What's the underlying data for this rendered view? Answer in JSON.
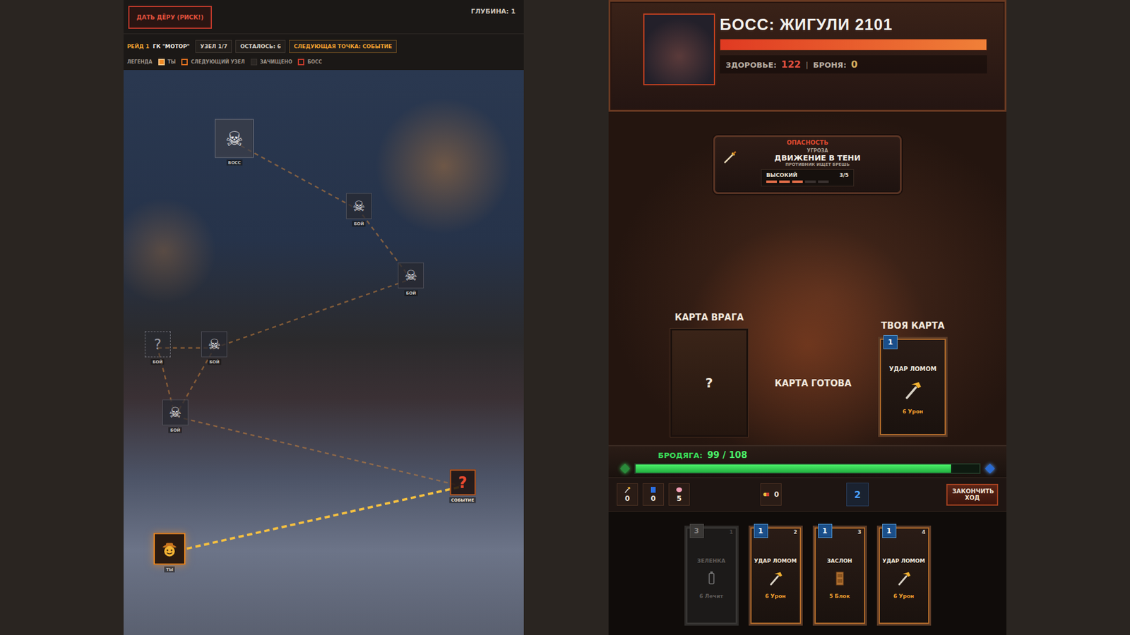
{
  "map_panel": {
    "flee_button": "ДАТЬ ДЁРУ (РИСК!)",
    "depth": "ГЛУБИНА: 1",
    "raid": "РЕЙД 1",
    "location": "ГК \"МОТОР\"",
    "chips": [
      {
        "label": "УЗЕЛ 1/7",
        "highlight": false
      },
      {
        "label": "ОСТАЛОСЬ: 6",
        "highlight": false
      },
      {
        "label": "СЛЕДУЮЩАЯ ТОЧКА: СОБЫТИЕ",
        "highlight": true
      }
    ],
    "legend": {
      "title": "ЛЕГЕНДА",
      "items": [
        {
          "label": "ТЫ",
          "kind": "you"
        },
        {
          "label": "СЛЕДУЮЩИЙ УЗЕЛ",
          "kind": "next"
        },
        {
          "label": "ЗАЧИЩЕНО",
          "kind": "cleared"
        },
        {
          "label": "БОСС",
          "kind": "boss"
        }
      ]
    },
    "nodes": [
      {
        "label": "БОСС",
        "glyph": "☠",
        "kind": "boss"
      },
      {
        "label": "БОЙ",
        "glyph": "☠",
        "kind": "fight"
      },
      {
        "label": "БОЙ",
        "glyph": "☠",
        "kind": "fight"
      },
      {
        "label": "БОЙ",
        "glyph": "?",
        "kind": "unknown"
      },
      {
        "label": "БОЙ",
        "glyph": "☠",
        "kind": "fight"
      },
      {
        "label": "БОЙ",
        "glyph": "☠",
        "kind": "fight"
      },
      {
        "label": "СОБЫТИЕ",
        "glyph": "?",
        "kind": "next"
      },
      {
        "label": "ТЫ",
        "glyph": "",
        "kind": "you"
      }
    ]
  },
  "battle": {
    "boss": {
      "title": "БОСС: ЖИГУЛИ 2101",
      "hp_level": 1,
      "health_label": "ЗДОРОВЬЕ:",
      "health": "122",
      "separator": "|",
      "armor_label": "БРОНЯ:",
      "armor": "0"
    },
    "threat": {
      "header": "ОПАСНОСТЬ",
      "kicker": "УГРОЗА",
      "title": "ДВИЖЕНИЕ В ТЕНИ",
      "subtitle": "ПРОТИВНИК ИЩЕТ БРЕШЬ",
      "level_label": "ВЫСОКИЙ",
      "level_text": "3/5",
      "segments": [
        true,
        true,
        true,
        false,
        false
      ]
    },
    "enemy_card": {
      "label": "КАРТА ВРАГА",
      "glyph": "?"
    },
    "status": "КАРТА ГОТОВА",
    "played_card": {
      "label": "ТВОЯ КАРТА",
      "cost": "1",
      "name": "УДАР ЛОМОМ",
      "effect": "6 Урон",
      "kind": "attack"
    },
    "player": {
      "name": "БРОДЯГА:",
      "hp": "99 / 108",
      "level": 0.917
    },
    "stats": [
      {
        "value": "0",
        "kind": "attack"
      },
      {
        "value": "0",
        "kind": "shield"
      },
      {
        "value": "5",
        "kind": "brain"
      }
    ],
    "pills": "0",
    "energy": "2",
    "end_turn": "ЗАКОНЧИТЬ ХОД",
    "hand": [
      {
        "cost": "3",
        "index": "1",
        "name": "ЗЕЛЕНКА",
        "effect": "6 Лечит",
        "kind": "heal",
        "disabled": true
      },
      {
        "cost": "1",
        "index": "2",
        "name": "УДАР ЛОМОМ",
        "effect": "6 Урон",
        "kind": "attack",
        "disabled": false
      },
      {
        "cost": "1",
        "index": "3",
        "name": "ЗАСЛОН",
        "effect": "5 Блок",
        "kind": "block",
        "disabled": false
      },
      {
        "cost": "1",
        "index": "4",
        "name": "УДАР ЛОМОМ",
        "effect": "6 Урон",
        "kind": "attack",
        "disabled": false
      }
    ]
  }
}
